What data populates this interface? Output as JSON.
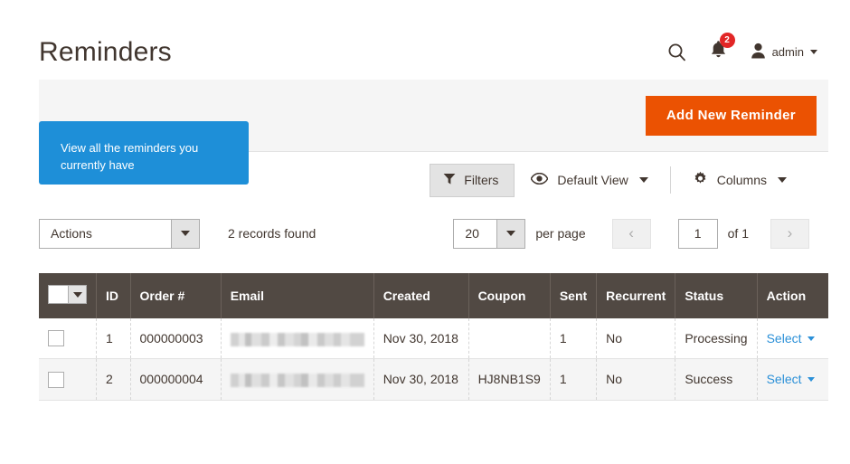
{
  "header": {
    "title": "Reminders",
    "search_icon": "search-icon",
    "notifications": {
      "icon": "bell-icon",
      "badge": "2"
    },
    "user": {
      "icon": "user-avatar-icon",
      "name": "admin"
    }
  },
  "action_strip": {
    "add_button_label": "Add New Reminder"
  },
  "tooltip": {
    "text": "View all the reminders you currently have",
    "background": "#1e8fd8"
  },
  "grid_toolbar": {
    "filters_label": "Filters",
    "filters_icon": "funnel-icon",
    "view_label": "Default View",
    "view_icon": "eye-icon",
    "columns_label": "Columns",
    "columns_icon": "gear-icon"
  },
  "controls": {
    "actions_label": "Actions",
    "records_found": "2 records found",
    "per_page_value": "20",
    "per_page_label": "per page",
    "prev_glyph": "‹",
    "next_glyph": "›",
    "current_page": "1",
    "of_pages": "of 1"
  },
  "grid": {
    "columns": [
      {
        "key": "check",
        "label": ""
      },
      {
        "key": "id",
        "label": "ID"
      },
      {
        "key": "order",
        "label": "Order #"
      },
      {
        "key": "email",
        "label": "Email"
      },
      {
        "key": "created",
        "label": "Created"
      },
      {
        "key": "coupon",
        "label": "Coupon"
      },
      {
        "key": "sent",
        "label": "Sent"
      },
      {
        "key": "recurrent",
        "label": "Recurrent"
      },
      {
        "key": "status",
        "label": "Status"
      },
      {
        "key": "action",
        "label": "Action"
      }
    ],
    "rows": [
      {
        "id": "1",
        "order": "000000003",
        "email": "",
        "email_redacted": true,
        "created": "Nov 30, 2018",
        "coupon": "",
        "sent": "1",
        "recurrent": "No",
        "status": "Processing",
        "action": "Select"
      },
      {
        "id": "2",
        "order": "000000004",
        "email": "",
        "email_redacted": true,
        "created": "Nov 30, 2018",
        "coupon": "HJ8NB1S9",
        "sent": "1",
        "recurrent": "No",
        "status": "Success",
        "action": "Select"
      }
    ]
  },
  "colors": {
    "primary_button": "#eb5202",
    "grid_header": "#514943",
    "link": "#2b90d8",
    "badge": "#e22626",
    "tooltip": "#1e8fd8"
  }
}
